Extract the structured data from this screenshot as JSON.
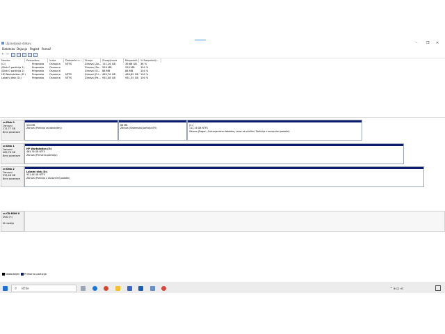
{
  "window": {
    "title": "Upravljanje diskov",
    "controls": [
      "–",
      "❐",
      "✕"
    ]
  },
  "menu": [
    "Datoteka",
    "Dejanje",
    "Pogled",
    "Pomoč"
  ],
  "columns": [
    "Nosilec",
    "Postavitev",
    "Vrsta",
    "Datotečni s...",
    "Stanje",
    "Zmogljivost",
    "Razpoložl...",
    "% Razpoložlj..."
  ],
  "volumes": [
    [
      "(C:)",
      "Preprosta",
      "Osnovna",
      "NTFS",
      "Zdrava (Za...",
      "111,16 GB",
      "39,68 GB",
      "36 %"
    ],
    [
      "(Disk 0 particija 1)",
      "Preprosta",
      "Osnovna",
      "",
      "Zdrava (Za...",
      "520 MB",
      "520 MB",
      "100 %"
    ],
    [
      "(Disk 0 particija 2)",
      "Preprosta",
      "Osnovna",
      "",
      "Zdrava (Si...",
      "88 MB",
      "88 MB",
      "100 %"
    ],
    [
      "HP Workstation (E:)",
      "Preprosta",
      "Osnovna",
      "NTFS",
      "Zdrava (Pri...",
      "465,76 GB",
      "465,65 GB",
      "100 %"
    ],
    [
      "Lokalni disk (D:)",
      "Preprosta",
      "Osnovna",
      "NTFS",
      "Zdrava (Pa...",
      "931,48 GB",
      "931,35 GB",
      "100 %"
    ]
  ],
  "disks": [
    {
      "name": "Disk 0",
      "type": "Osnovni",
      "size": "111,77 GB",
      "status": "Brez povezave",
      "parts": [
        {
          "title": "",
          "size": "520 MB",
          "desc": "Zdrava (Particija za obnovitev)"
        },
        {
          "title": "",
          "size": "88 MB",
          "desc": "Zdrava (Sistemska particija EFI)"
        },
        {
          "title": "(C:)",
          "size": "111,16 GB NTFS",
          "desc": "Zdrava (Zagon, Ostranjevalna datoteka, Izvoz ob zrušitvi, Particija z osnovnimi podatki)"
        }
      ]
    },
    {
      "name": "Disk 1",
      "type": "Osnovni",
      "size": "465,76 GB",
      "status": "Brez povezave",
      "parts": [
        {
          "title": "HP Workstation (E:)",
          "size": "465,76 GB NTFS",
          "desc": "Zdrava (Primarna particija)"
        }
      ]
    },
    {
      "name": "Disk 2",
      "type": "Osnovni",
      "size": "931,48 GB",
      "status": "Brez povezave",
      "parts": [
        {
          "title": "Lokalni disk (D:)",
          "size": "931,48 GB NTFS",
          "desc": "Zdrava (Particija z osnovnimi podatki)"
        }
      ]
    }
  ],
  "cdrom": {
    "name": "CD-ROM 0",
    "drive": "DVD (F:)",
    "media": "Ni medija"
  },
  "legend": [
    {
      "label": "Nedodeljen",
      "color": "#000000"
    },
    {
      "label": "Primarna particija",
      "color": "#0c1d6e"
    }
  ],
  "taskbar": {
    "search_text": "Iščite",
    "tray": "^ ⊕ ◫ ⊲)"
  },
  "colors": {
    "partition_bar": "#0c1d6e",
    "taskbar": "#ececec"
  }
}
